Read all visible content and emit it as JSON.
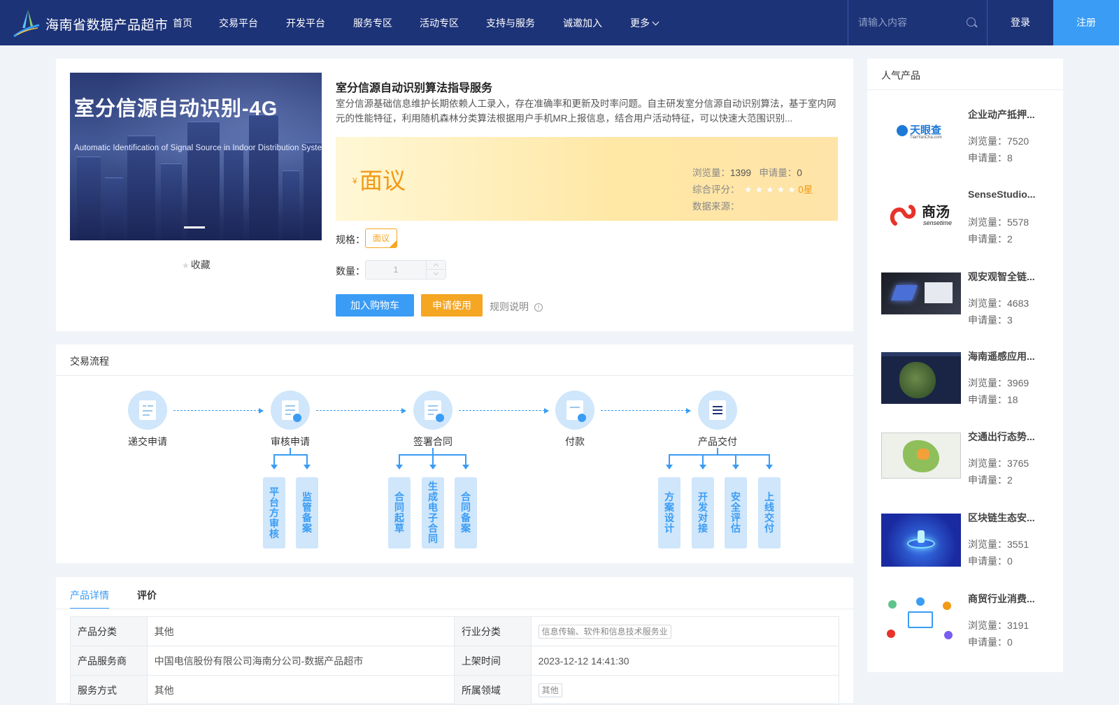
{
  "brand": {
    "name": "海南省数据产品超市"
  },
  "nav": [
    {
      "label": "首页"
    },
    {
      "label": "交易平台"
    },
    {
      "label": "开发平台"
    },
    {
      "label": "服务专区"
    },
    {
      "label": "活动专区"
    },
    {
      "label": "支持与服务"
    },
    {
      "label": "诚邀加入"
    },
    {
      "label": "更多"
    }
  ],
  "search": {
    "placeholder": "请输入内容"
  },
  "auth": {
    "login": "登录",
    "register": "注册"
  },
  "product": {
    "image_title": "室分信源自动识别-4G",
    "image_subtitle": "Automatic Identification of Signal Source in Indoor Distribution System",
    "title": "室分信源自动识别算法指导服务",
    "description": "室分信源基础信息维护长期依赖人工录入，存在准确率和更新及时率问题。自主研发室分信源自动识别算法，基于室内网元的性能特征，利用随机森林分类算法根据用户手机MR上报信息，结合用户活动特征，可以快速大范围识别...",
    "favorite_label": "收藏",
    "price_symbol": "¥",
    "price": "面议",
    "views_label": "浏览量：",
    "views": "1399",
    "applies_label": "申请量：",
    "applies": "0",
    "rating_label": "综合评分：",
    "rating_stars": "★★★★★",
    "rating": 0,
    "rating_text": "0星",
    "source_label": "数据来源：",
    "source": "",
    "spec_label": "规格：",
    "spec_value": "面议",
    "qty_label": "数量：",
    "qty_value": "1",
    "add_cart": "加入购物车",
    "apply": "申请使用",
    "rules": "规则说明",
    "rules_icon": "!"
  },
  "flow": {
    "title": "交易流程",
    "steps": [
      {
        "label": "递交申请",
        "icon": "form-icon"
      },
      {
        "label": "审核申请",
        "icon": "review-icon"
      },
      {
        "label": "签署合同",
        "icon": "contract-icon"
      },
      {
        "label": "付款",
        "icon": "payment-icon"
      },
      {
        "label": "产品交付",
        "icon": "delivery-icon"
      }
    ],
    "substeps": [
      [
        "平台方审核",
        "监管备案"
      ],
      [
        "合同起草",
        "生成电子合同",
        "合同备案"
      ],
      [],
      [
        "方案设计",
        "开发对接",
        "安全评估",
        "上线交付"
      ]
    ]
  },
  "detail": {
    "tabs": [
      "产品详情",
      "评价"
    ],
    "rows": [
      {
        "k1": "产品分类",
        "v1": "其他",
        "k2": "行业分类",
        "v2": "信息传输、软件和信息技术服务业"
      },
      {
        "k1": "产品服务商",
        "v1": "中国电信股份有限公司海南分公司-数据产品超市",
        "k2": "上架时间",
        "v2": "2023-12-12 14:41:30"
      },
      {
        "k1": "服务方式",
        "v1": "其他",
        "k2": "所属领域",
        "v2": "其他"
      }
    ]
  },
  "side": {
    "title": "人气产品",
    "views_label": "浏览量：",
    "applies_label": "申请量：",
    "items": [
      {
        "name": "企业动产抵押...",
        "views": "7520",
        "applies": "8",
        "logo_text": "天眼查",
        "logo_sub": "TianYanCha.com"
      },
      {
        "name": "SenseStudio...",
        "views": "5578",
        "applies": "2",
        "logo_text": "商汤",
        "logo_sub": "sensetime"
      },
      {
        "name": "观安观智全链...",
        "views": "4683",
        "applies": "3"
      },
      {
        "name": "海南遥感应用...",
        "views": "3969",
        "applies": "18"
      },
      {
        "name": "交通出行态势...",
        "views": "3765",
        "applies": "2"
      },
      {
        "name": "区块链生态安...",
        "views": "3551",
        "applies": "0"
      },
      {
        "name": "商贸行业消费...",
        "views": "3191",
        "applies": "0"
      }
    ]
  }
}
